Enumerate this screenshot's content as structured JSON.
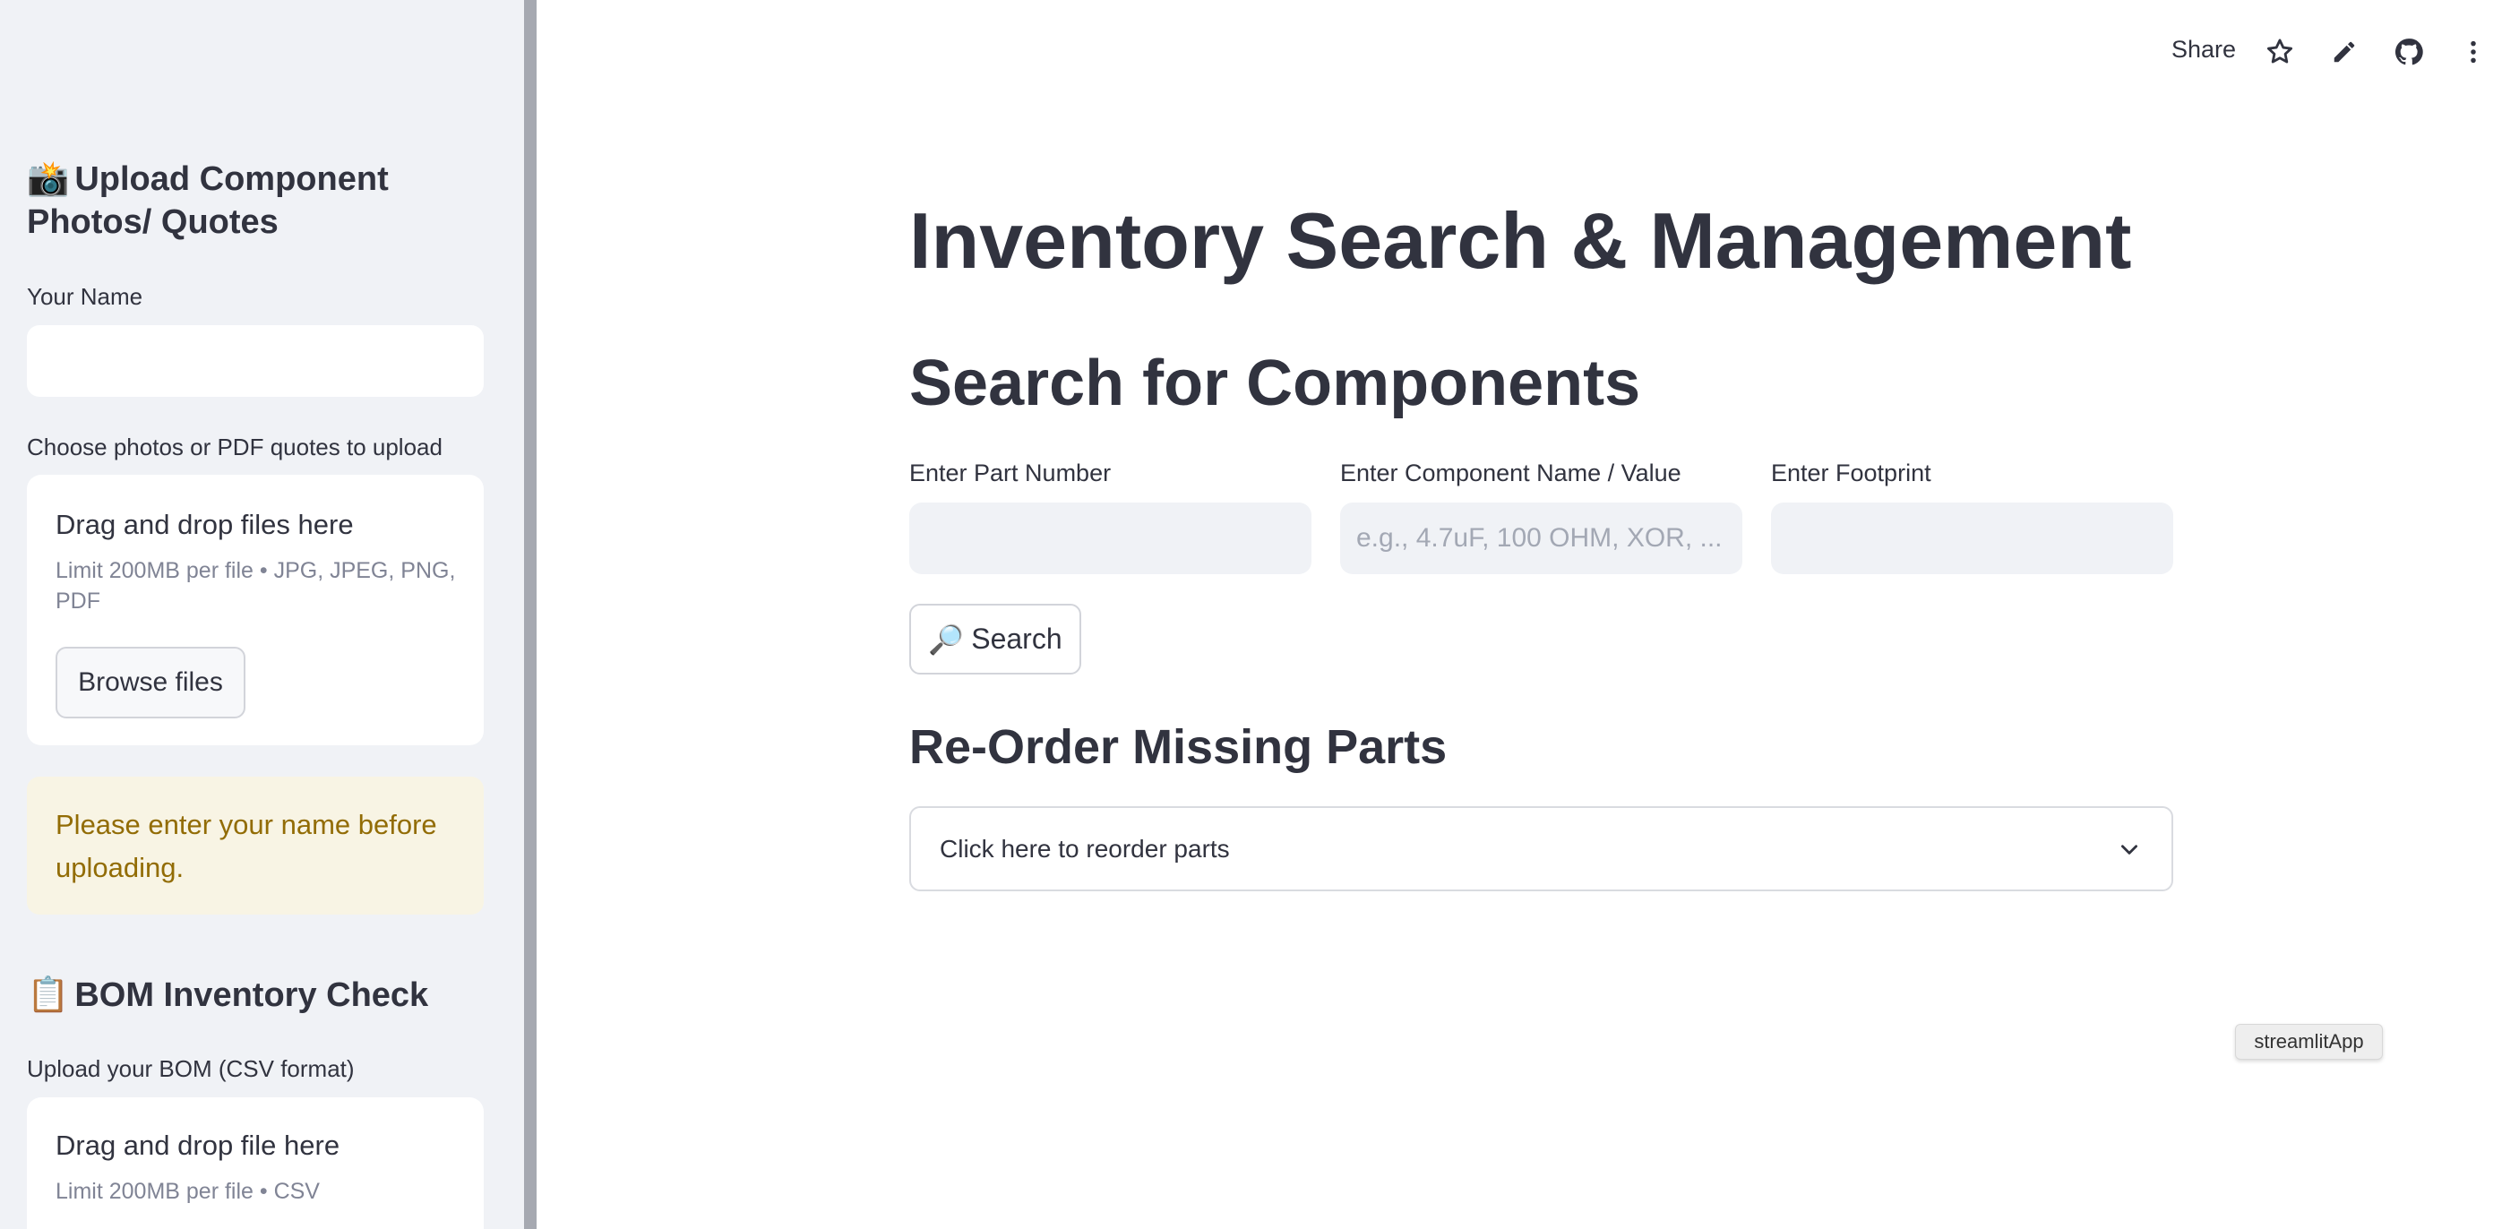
{
  "sidebar": {
    "upload_heading_emoji": "📸",
    "upload_heading": "Upload Component Photos/ Quotes",
    "name_label": "Your Name",
    "name_value": "",
    "photos_label": "Choose photos or PDF quotes to upload",
    "photos_dropzone": {
      "title": "Drag and drop files here",
      "limit": "Limit 200MB per file • JPG, JPEG, PNG, PDF",
      "button": "Browse files"
    },
    "warning": "Please enter your name before uploading.",
    "bom_heading_emoji": "📋",
    "bom_heading": "BOM Inventory Check",
    "bom_label": "Upload your BOM (CSV format)",
    "bom_dropzone": {
      "title": "Drag and drop file here",
      "limit": "Limit 200MB per file • CSV"
    }
  },
  "toolbar": {
    "share_label": "Share",
    "icons": [
      "star-icon",
      "pencil-icon",
      "github-icon",
      "more-vertical-icon"
    ]
  },
  "main": {
    "title": "Inventory Search & Management",
    "search_heading": "Search for Components",
    "fields": {
      "part_number": {
        "label": "Enter Part Number",
        "value": "",
        "placeholder": ""
      },
      "component_name": {
        "label": "Enter Component Name / Value",
        "value": "",
        "placeholder": "e.g., 4.7uF, 100 OHM, XOR, ..."
      },
      "footprint": {
        "label": "Enter Footprint",
        "value": "",
        "placeholder": ""
      }
    },
    "search_button_icon": "🔎",
    "search_button": "Search",
    "reorder_heading": "Re-Order Missing Parts",
    "reorder_expander": "Click here to reorder parts"
  },
  "tooltip": "streamlitApp",
  "colors": {
    "sidebar_bg": "#f0f2f6",
    "text": "#31333f",
    "warning_bg": "#f8f4e4",
    "warning_text": "#926c05"
  }
}
